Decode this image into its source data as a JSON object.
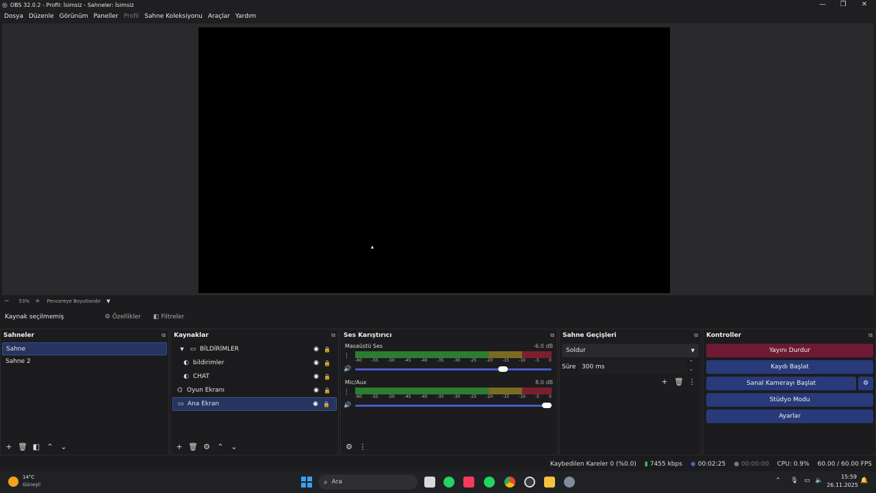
{
  "window": {
    "title": "OBS 32.0.2 - Profil: İsimsiz - Sahneler: İsimsiz"
  },
  "menu": [
    "Dosya",
    "Düzenle",
    "Görünüm",
    "Paneller",
    "Profil",
    "Sahne Koleksiyonu",
    "Araçlar",
    "Yardım"
  ],
  "zoom": {
    "minus": "−",
    "value": "53%",
    "plus": "+",
    "mode": "Pencereye Boyutlandır"
  },
  "source_bar": {
    "status": "Kaynak seçilmemiş",
    "properties": "Özellikler",
    "filters": "Filtreler"
  },
  "scenes": {
    "title": "Sahneler",
    "items": [
      "Sahne",
      "Sahne 2"
    ],
    "selected": 0
  },
  "sources": {
    "title": "Kaynaklar",
    "items": [
      {
        "label": "BİLDİRİMLER",
        "icon": "folder-icon",
        "indent": 0
      },
      {
        "label": "bildirimler",
        "icon": "browser-icon",
        "indent": 1
      },
      {
        "label": "CHAT",
        "icon": "browser-icon",
        "indent": 1
      },
      {
        "label": "Oyun Ekranı",
        "icon": "gamepad-icon",
        "indent": 0
      },
      {
        "label": "Ana Ekran",
        "icon": "monitor-icon",
        "indent": 0
      }
    ]
  },
  "mixer": {
    "title": "Ses Karıştırıcı",
    "channels": [
      {
        "name": "Masaüstü Ses",
        "db": "-6.0 dB",
        "volume": 0.71
      },
      {
        "name": "Mic/Aux",
        "db": "8.0 dB",
        "volume": 1.0
      }
    ],
    "ticks": [
      "-60",
      "-55",
      "-50",
      "-45",
      "-40",
      "-35",
      "-30",
      "-25",
      "-20",
      "-15",
      "-10",
      "-5",
      "0"
    ]
  },
  "transitions": {
    "title": "Sahne Geçişleri",
    "selected": "Soldur",
    "duration_label": "Süre",
    "duration": "300 ms"
  },
  "controls": {
    "title": "Kontroller",
    "stop_stream": "Yayını Durdur",
    "start_record": "Kaydı Başlat",
    "start_vcam": "Sanal Kamerayı Başlat",
    "studio_mode": "Stüdyo Modu",
    "settings": "Ayarlar"
  },
  "status": {
    "dropped": "Kaybedilen Kareler 0 (%0.0)",
    "bitrate": "7455 kbps",
    "stream_time": "00:02:25",
    "record_time": "00:00:00",
    "cpu": "CPU: 0.9%",
    "fps": "60.00 / 60.00 FPS"
  },
  "taskbar": {
    "weather_temp": "14°C",
    "weather_desc": "Güneşli",
    "search": "Ara",
    "time": "15:59",
    "date": "26.11.2025"
  },
  "colors": {
    "selected": "#26345f",
    "stop_stream": "#6e1a34",
    "controls_button": "#283a7a"
  }
}
